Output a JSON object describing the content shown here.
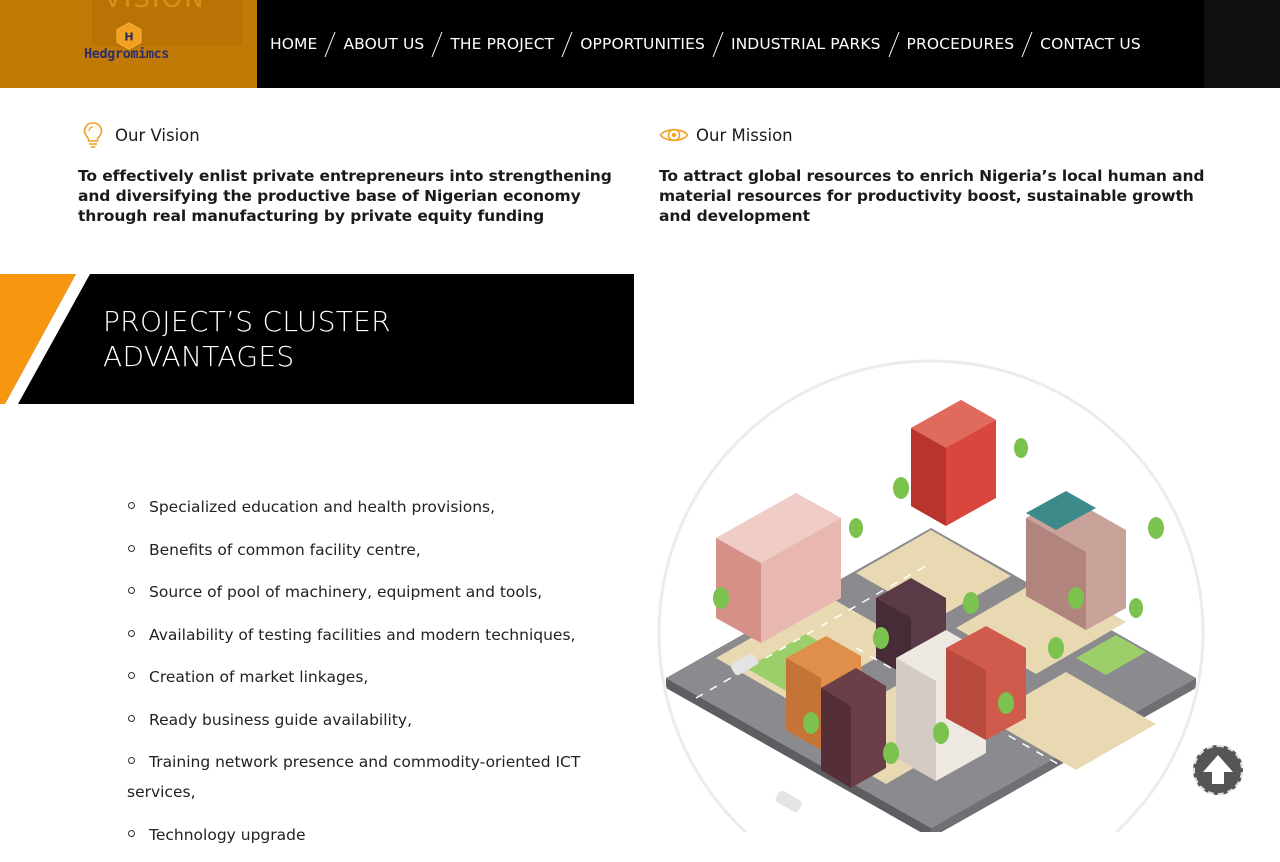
{
  "header": {
    "logo_letter": "H",
    "logo_text": "Hedgromimcs",
    "logo_ghost_text": "VISION",
    "nav": [
      {
        "label": "HOME"
      },
      {
        "label": "ABOUT US"
      },
      {
        "label": "THE PROJECT"
      },
      {
        "label": "OPPORTUNITIES"
      },
      {
        "label": "INDUSTRIAL PARKS"
      },
      {
        "label": "PROCEDURES"
      },
      {
        "label": "CONTACT US"
      }
    ]
  },
  "vision": {
    "icon": "lightbulb-icon",
    "title": "Our Vision",
    "text": "To effectively enlist private entrepreneurs into strengthening and diversifying the productive base of Nigerian economy through real manufacturing by private equity funding"
  },
  "mission": {
    "icon": "eye-icon",
    "title": "Our Mission",
    "text": "To attract global resources to enrich Nigeria’s local human and material resources for productivity boost, sustainable growth and development"
  },
  "cluster": {
    "title_line1": "PROJECT’S CLUSTER",
    "title_line2": "ADVANTAGES",
    "items": [
      "Specialized education and health provisions,",
      "Benefits of common facility centre,",
      "Source of pool of machinery, equipment and tools,",
      "Availability of testing facilities and modern techniques,",
      "Creation of market linkages,",
      "Ready business guide availability,",
      "Training network presence and commodity-oriented ICT services,",
      "Technology upgrade"
    ]
  },
  "illustration": {
    "subject": "isometric-city-illustration"
  },
  "scroll_top": {
    "icon": "arrow-up-icon"
  },
  "colors": {
    "accent": "#f7960f",
    "logo_bg": "#c27a06",
    "header_bg": "#000000",
    "text": "#1a1a1a"
  }
}
